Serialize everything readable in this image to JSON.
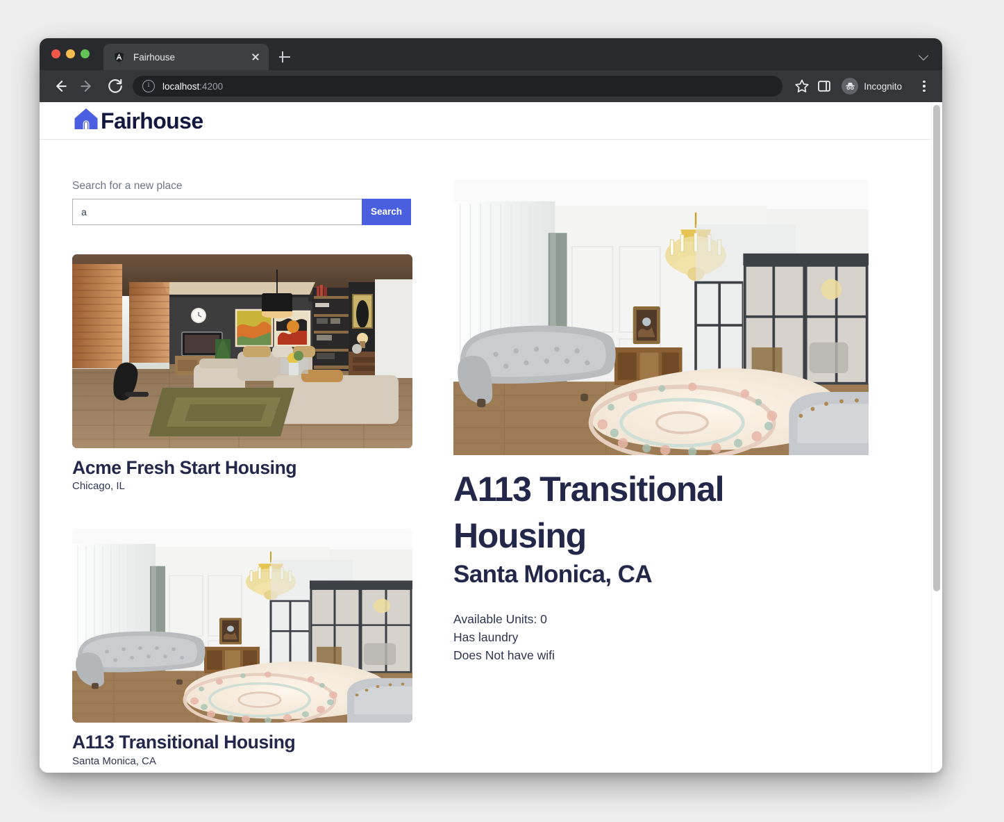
{
  "browser": {
    "tab": {
      "title": "Fairhouse",
      "favicon": "angular-shield-icon",
      "close_label": "close-tab"
    },
    "new_tab_label": "+",
    "toolbar": {
      "back_label": "Back",
      "forward_label": "Forward",
      "reload_label": "Reload",
      "url_prefix": "localhost",
      "url_suffix": ":4200",
      "site_info": "info-icon",
      "bookmark": "star-icon",
      "side_panel": "side-panel-icon",
      "profile_label": "Incognito",
      "menu_label": "Chrome menu"
    }
  },
  "app": {
    "brand_name": "Fairhouse",
    "search": {
      "label": "Search for a new place",
      "value": "a",
      "placeholder": "",
      "button_label": "Search"
    },
    "listings": [
      {
        "name": "Acme Fresh Start Housing",
        "city": "Chicago, IL",
        "photo": "dark-modern-living-room"
      },
      {
        "name": "A113 Transitional Housing",
        "city": "Santa Monica, CA",
        "photo": "bright-white-living-room-chandelier"
      }
    ],
    "detail": {
      "name": "A113 Transitional Housing",
      "city": "Santa Monica, CA",
      "photo": "bright-white-living-room-chandelier",
      "facts": [
        "Available Units: 0",
        "Has laundry",
        "Does Not have wifi"
      ]
    }
  },
  "colors": {
    "accent": "#4a5fe0",
    "heading": "#23284b",
    "muted": "#6c7486",
    "browser_tabstrip": "#292a2d",
    "browser_toolbar": "#35363a"
  }
}
